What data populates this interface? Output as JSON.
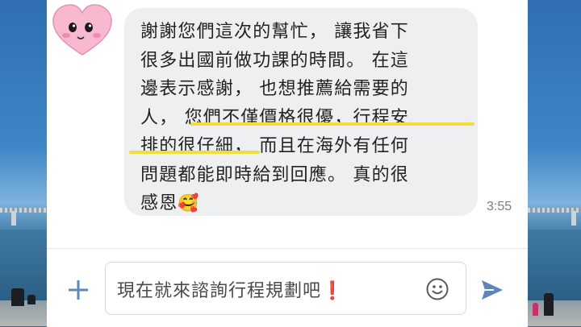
{
  "message": {
    "lines": [
      "謝謝您們這次的幫忙， 讓我省下",
      "很多出國前做功課的時間。 在這",
      "邊表示感謝， 也想推薦給需要的",
      "人， 您們不僅價格很優，行程安",
      "排的很仔細， 而且在海外有任何",
      "問題都能即時給到回應。 真的很"
    ],
    "last_line_text": "感恩",
    "last_line_emoji": "🥰",
    "time": "3:55"
  },
  "composer": {
    "input_text": "現在就來諮詢行程規劃吧",
    "input_emoji": "❗"
  },
  "colors": {
    "bubble": "#eeeff1",
    "highlight": "#f1de3a",
    "send_icon": "#5e86b8",
    "avatar_heart": "#f8b8cf"
  },
  "icons": {
    "avatar": "pink-heart-character-icon",
    "add": "plus-icon",
    "emoji_picker": "smiley-icon",
    "send": "send-arrow-icon"
  }
}
